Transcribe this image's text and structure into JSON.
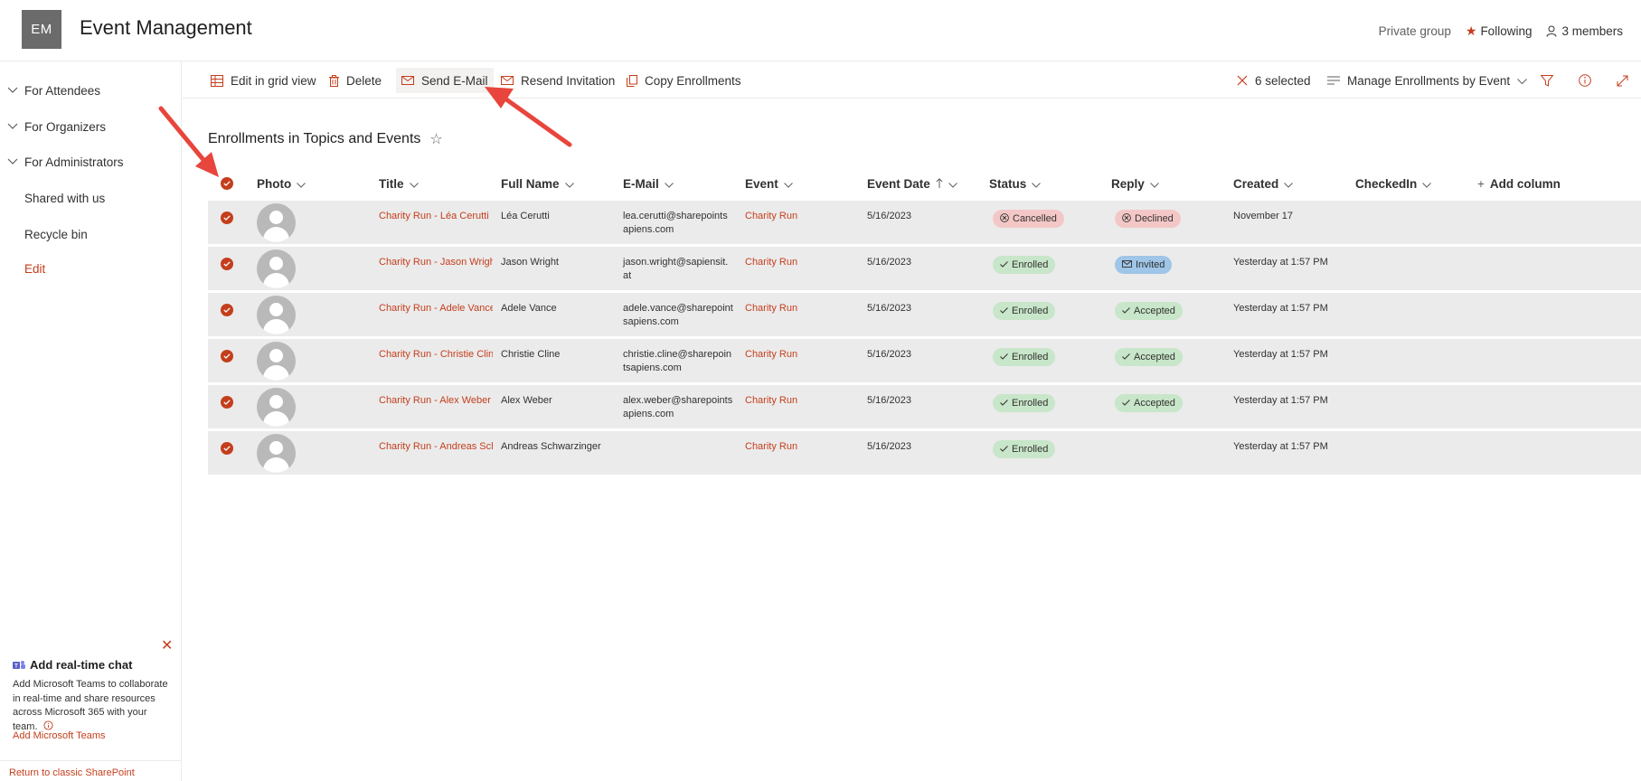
{
  "header": {
    "logo_initials": "EM",
    "site_title": "Event Management",
    "privacy": "Private group",
    "following": "Following",
    "members": "3 members"
  },
  "nav": {
    "items": [
      {
        "label": "For Attendees"
      },
      {
        "label": "For Organizers"
      },
      {
        "label": "For Administrators"
      },
      {
        "label": "Shared with us"
      },
      {
        "label": "Recycle bin"
      },
      {
        "label": "Edit"
      }
    ]
  },
  "chat_panel": {
    "title": "Add real-time chat",
    "body": "Add Microsoft Teams to collaborate in real-time and share resources across Microsoft 365 with your team.",
    "link": "Add Microsoft Teams",
    "classic": "Return to classic SharePoint"
  },
  "commands": {
    "edit_grid": "Edit in grid view",
    "delete": "Delete",
    "send_email": "Send E-Mail",
    "resend": "Resend Invitation",
    "copy": "Copy Enrollments",
    "selected": "6 selected",
    "view": "Manage Enrollments by Event"
  },
  "list": {
    "title": "Enrollments in Topics and Events",
    "columns": {
      "photo": "Photo",
      "title": "Title",
      "full_name": "Full Name",
      "email": "E-Mail",
      "event": "Event",
      "event_date": "Event Date",
      "status": "Status",
      "reply": "Reply",
      "created": "Created",
      "checkedin": "CheckedIn",
      "add_column": "Add column"
    },
    "rows": [
      {
        "title": "Charity Run - Léa Cerutti",
        "full_name": "Léa Cerutti",
        "email1": "lea.cerutti@sharepoints",
        "email2": "apiens.com",
        "event": "Charity Run",
        "event_date": "5/16/2023",
        "status": "Cancelled",
        "reply": "Declined",
        "created": "November 17"
      },
      {
        "title": "Charity Run - Jason Wrigh",
        "full_name": "Jason Wright",
        "email1": "jason.wright@sapiensit.",
        "email2": "at",
        "event": "Charity Run",
        "event_date": "5/16/2023",
        "status": "Enrolled",
        "reply": "Invited",
        "created": "Yesterday at 1:57 PM"
      },
      {
        "title": "Charity Run - Adele Vance",
        "full_name": "Adele Vance",
        "email1": "adele.vance@sharepoint",
        "email2": "sapiens.com",
        "event": "Charity Run",
        "event_date": "5/16/2023",
        "status": "Enrolled",
        "reply": "Accepted",
        "created": "Yesterday at 1:57 PM"
      },
      {
        "title": "Charity Run - Christie Clin",
        "full_name": "Christie Cline",
        "email1": "christie.cline@sharepoin",
        "email2": "tsapiens.com",
        "event": "Charity Run",
        "event_date": "5/16/2023",
        "status": "Enrolled",
        "reply": "Accepted",
        "created": "Yesterday at 1:57 PM"
      },
      {
        "title": "Charity Run - Alex Weber",
        "full_name": "Alex Weber",
        "email1": "alex.weber@sharepoints",
        "email2": "apiens.com",
        "event": "Charity Run",
        "event_date": "5/16/2023",
        "status": "Enrolled",
        "reply": "Accepted",
        "created": "Yesterday at 1:57 PM"
      },
      {
        "title": "Charity Run - Andreas Sch",
        "full_name": "Andreas Schwarzinger",
        "email1": "",
        "email2": "",
        "event": "Charity Run",
        "event_date": "5/16/2023",
        "status": "Enrolled",
        "reply": "",
        "created": "Yesterday at 1:57 PM"
      }
    ]
  },
  "colors": {
    "accent": "#c43e1c",
    "enrolled": "#c8e6c9",
    "cancelled": "#f4c7c7",
    "invited": "#9fc5e8",
    "row_selected": "#ebebeb",
    "annotation_arrow": "#e8453c"
  }
}
